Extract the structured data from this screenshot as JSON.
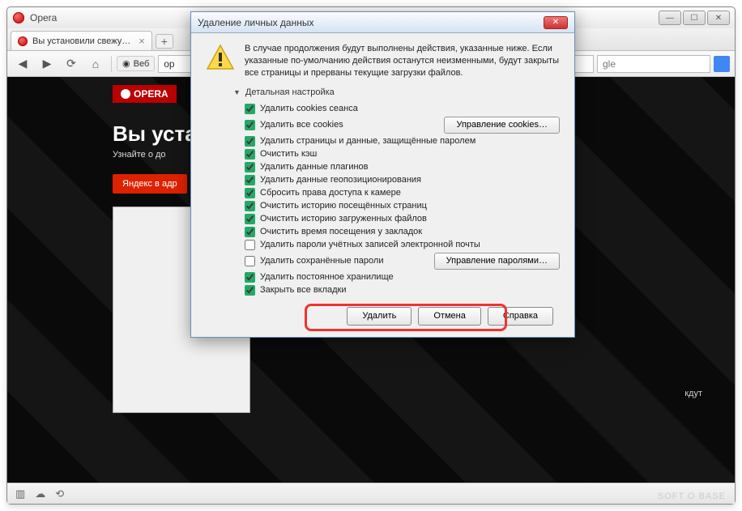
{
  "window": {
    "title": "Opera"
  },
  "tab": {
    "label": "Вы установили свежу…"
  },
  "toolbar": {
    "web_prefix": "Веб",
    "address_value": "op",
    "search_placeholder": "gle"
  },
  "page": {
    "logo": "OPERA",
    "headline": "Вы уста",
    "subline": "Узнайте о до",
    "yandex": "Яндекс в адр",
    "waits": "кдут"
  },
  "dialog": {
    "title": "Удаление личных данных",
    "warning": "В случае продолжения будут выполнены действия, указанные ниже. Если указанные по-умолчанию действия останутся неизменными, будут закрыты все страницы и прерваны текущие загрузки файлов.",
    "detail_header": "Детальная настройка",
    "manage_cookies": "Управление cookies…",
    "manage_passwords": "Управление паролями…",
    "options": [
      {
        "label": "Удалить cookies сеанса",
        "checked": true
      },
      {
        "label": "Удалить все cookies",
        "checked": true,
        "manage": "cookies"
      },
      {
        "label": "Удалить страницы и данные, защищённые паролем",
        "checked": true
      },
      {
        "label": "Очистить кэш",
        "checked": true
      },
      {
        "label": "Удалить данные плагинов",
        "checked": true
      },
      {
        "label": "Удалить данные геопозиционирования",
        "checked": true
      },
      {
        "label": "Сбросить права доступа к камере",
        "checked": true
      },
      {
        "label": "Очистить историю посещённых страниц",
        "checked": true
      },
      {
        "label": "Очистить историю загруженных файлов",
        "checked": true
      },
      {
        "label": "Очистить время посещения у закладок",
        "checked": true
      },
      {
        "label": "Удалить пароли учётных записей электронной почты",
        "checked": false
      },
      {
        "label": "Удалить сохранённые пароли",
        "checked": false,
        "manage": "passwords"
      },
      {
        "label": "Удалить постоянное хранилище",
        "checked": true
      },
      {
        "label": "Закрыть все вкладки",
        "checked": true
      }
    ],
    "buttons": {
      "delete": "Удалить",
      "cancel": "Отмена",
      "help": "Справка"
    }
  },
  "watermark": "SOFT  O  BASE"
}
